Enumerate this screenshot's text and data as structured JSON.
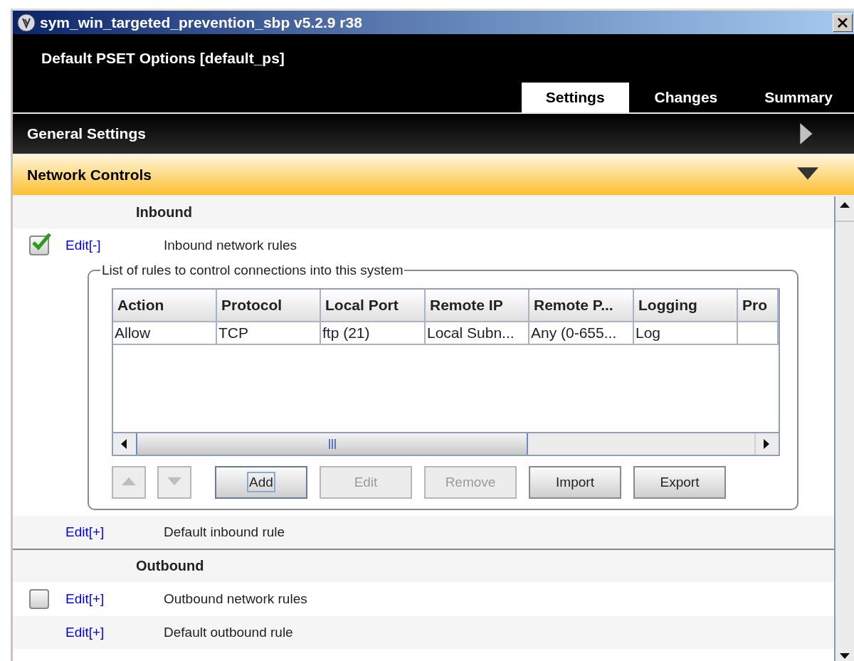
{
  "window": {
    "title": "sym_win_targeted_prevention_sbp v5.2.9 r38"
  },
  "header": {
    "title": "Default PSET Options [default_ps]"
  },
  "tabs": [
    {
      "label": "Settings",
      "selected": true
    },
    {
      "label": "Changes",
      "selected": false
    },
    {
      "label": "Summary",
      "selected": false
    }
  ],
  "sections": [
    {
      "title": "General Settings",
      "expanded": false
    },
    {
      "title": "Network Controls",
      "expanded": true
    }
  ],
  "groups": [
    {
      "heading": "Inbound",
      "rows": [
        {
          "kind": "toggle",
          "checked": true,
          "link": "Edit[-]",
          "label": "Inbound network rules",
          "panel": {
            "legend": "List of rules to control connections into this system",
            "columns": [
              "Action",
              "Protocol",
              "Local Port",
              "Remote IP",
              "Remote P...",
              "Logging",
              "Pro"
            ],
            "rows": [
              [
                "Allow",
                "TCP",
                "ftp (21)",
                "Local Subn...",
                "Any (0-655...",
                "Log",
                ""
              ]
            ],
            "move_buttons": [
              {
                "kind": "up",
                "disabled": true
              },
              {
                "kind": "down",
                "disabled": true
              }
            ],
            "buttons": [
              {
                "label": "Add",
                "disabled": false,
                "focused": true
              },
              {
                "label": "Edit",
                "disabled": true,
                "focused": false
              },
              {
                "label": "Remove",
                "disabled": true,
                "focused": false
              },
              {
                "label": "Import",
                "disabled": false,
                "focused": false
              },
              {
                "label": "Export",
                "disabled": false,
                "focused": false
              }
            ]
          }
        },
        {
          "kind": "plain",
          "link": "Edit[+]",
          "label": "Default inbound rule"
        }
      ]
    },
    {
      "heading": "Outbound",
      "rows": [
        {
          "kind": "toggle",
          "checked": false,
          "link": "Edit[+]",
          "label": "Outbound network rules"
        },
        {
          "kind": "plain",
          "link": "Edit[+]",
          "label": "Default outbound rule"
        }
      ]
    }
  ]
}
